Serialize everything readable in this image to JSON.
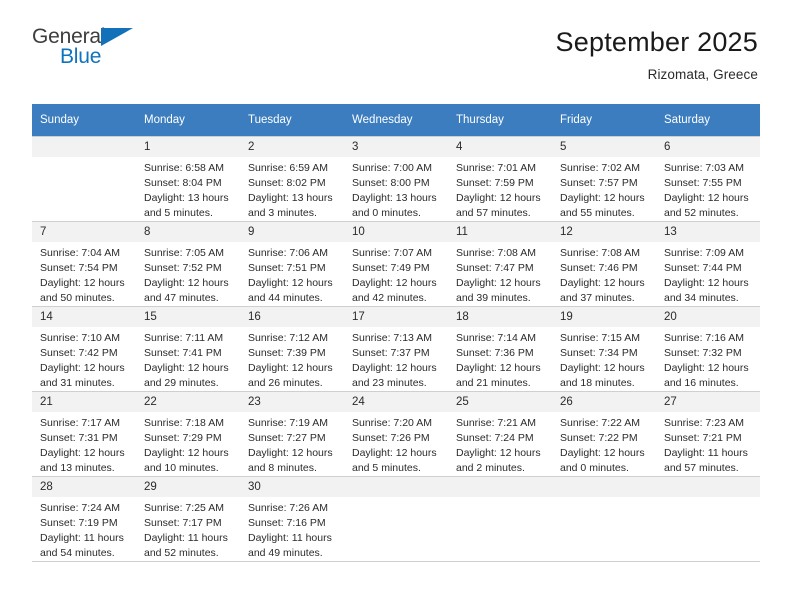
{
  "brand": {
    "name_part1": "General",
    "name_part2": "Blue",
    "accent_color": "#1271b8",
    "flag_icon": "triangle-flag-icon"
  },
  "header": {
    "title": "September 2025",
    "subtitle": "Rizomata, Greece"
  },
  "calendar": {
    "header_bg": "#3b7dbf",
    "daynum_bg": "#f2f2f2",
    "weekday_headers": [
      "Sunday",
      "Monday",
      "Tuesday",
      "Wednesday",
      "Thursday",
      "Friday",
      "Saturday"
    ],
    "weeks": [
      [
        {
          "day": "",
          "sunrise": "",
          "sunset": "",
          "daylight_line1": "",
          "daylight_line2": "",
          "blank": true
        },
        {
          "day": "1",
          "sunrise": "Sunrise: 6:58 AM",
          "sunset": "Sunset: 8:04 PM",
          "daylight_line1": "Daylight: 13 hours",
          "daylight_line2": "and 5 minutes."
        },
        {
          "day": "2",
          "sunrise": "Sunrise: 6:59 AM",
          "sunset": "Sunset: 8:02 PM",
          "daylight_line1": "Daylight: 13 hours",
          "daylight_line2": "and 3 minutes."
        },
        {
          "day": "3",
          "sunrise": "Sunrise: 7:00 AM",
          "sunset": "Sunset: 8:00 PM",
          "daylight_line1": "Daylight: 13 hours",
          "daylight_line2": "and 0 minutes."
        },
        {
          "day": "4",
          "sunrise": "Sunrise: 7:01 AM",
          "sunset": "Sunset: 7:59 PM",
          "daylight_line1": "Daylight: 12 hours",
          "daylight_line2": "and 57 minutes."
        },
        {
          "day": "5",
          "sunrise": "Sunrise: 7:02 AM",
          "sunset": "Sunset: 7:57 PM",
          "daylight_line1": "Daylight: 12 hours",
          "daylight_line2": "and 55 minutes."
        },
        {
          "day": "6",
          "sunrise": "Sunrise: 7:03 AM",
          "sunset": "Sunset: 7:55 PM",
          "daylight_line1": "Daylight: 12 hours",
          "daylight_line2": "and 52 minutes."
        }
      ],
      [
        {
          "day": "7",
          "sunrise": "Sunrise: 7:04 AM",
          "sunset": "Sunset: 7:54 PM",
          "daylight_line1": "Daylight: 12 hours",
          "daylight_line2": "and 50 minutes."
        },
        {
          "day": "8",
          "sunrise": "Sunrise: 7:05 AM",
          "sunset": "Sunset: 7:52 PM",
          "daylight_line1": "Daylight: 12 hours",
          "daylight_line2": "and 47 minutes."
        },
        {
          "day": "9",
          "sunrise": "Sunrise: 7:06 AM",
          "sunset": "Sunset: 7:51 PM",
          "daylight_line1": "Daylight: 12 hours",
          "daylight_line2": "and 44 minutes."
        },
        {
          "day": "10",
          "sunrise": "Sunrise: 7:07 AM",
          "sunset": "Sunset: 7:49 PM",
          "daylight_line1": "Daylight: 12 hours",
          "daylight_line2": "and 42 minutes."
        },
        {
          "day": "11",
          "sunrise": "Sunrise: 7:08 AM",
          "sunset": "Sunset: 7:47 PM",
          "daylight_line1": "Daylight: 12 hours",
          "daylight_line2": "and 39 minutes."
        },
        {
          "day": "12",
          "sunrise": "Sunrise: 7:08 AM",
          "sunset": "Sunset: 7:46 PM",
          "daylight_line1": "Daylight: 12 hours",
          "daylight_line2": "and 37 minutes."
        },
        {
          "day": "13",
          "sunrise": "Sunrise: 7:09 AM",
          "sunset": "Sunset: 7:44 PM",
          "daylight_line1": "Daylight: 12 hours",
          "daylight_line2": "and 34 minutes."
        }
      ],
      [
        {
          "day": "14",
          "sunrise": "Sunrise: 7:10 AM",
          "sunset": "Sunset: 7:42 PM",
          "daylight_line1": "Daylight: 12 hours",
          "daylight_line2": "and 31 minutes."
        },
        {
          "day": "15",
          "sunrise": "Sunrise: 7:11 AM",
          "sunset": "Sunset: 7:41 PM",
          "daylight_line1": "Daylight: 12 hours",
          "daylight_line2": "and 29 minutes."
        },
        {
          "day": "16",
          "sunrise": "Sunrise: 7:12 AM",
          "sunset": "Sunset: 7:39 PM",
          "daylight_line1": "Daylight: 12 hours",
          "daylight_line2": "and 26 minutes."
        },
        {
          "day": "17",
          "sunrise": "Sunrise: 7:13 AM",
          "sunset": "Sunset: 7:37 PM",
          "daylight_line1": "Daylight: 12 hours",
          "daylight_line2": "and 23 minutes."
        },
        {
          "day": "18",
          "sunrise": "Sunrise: 7:14 AM",
          "sunset": "Sunset: 7:36 PM",
          "daylight_line1": "Daylight: 12 hours",
          "daylight_line2": "and 21 minutes."
        },
        {
          "day": "19",
          "sunrise": "Sunrise: 7:15 AM",
          "sunset": "Sunset: 7:34 PM",
          "daylight_line1": "Daylight: 12 hours",
          "daylight_line2": "and 18 minutes."
        },
        {
          "day": "20",
          "sunrise": "Sunrise: 7:16 AM",
          "sunset": "Sunset: 7:32 PM",
          "daylight_line1": "Daylight: 12 hours",
          "daylight_line2": "and 16 minutes."
        }
      ],
      [
        {
          "day": "21",
          "sunrise": "Sunrise: 7:17 AM",
          "sunset": "Sunset: 7:31 PM",
          "daylight_line1": "Daylight: 12 hours",
          "daylight_line2": "and 13 minutes."
        },
        {
          "day": "22",
          "sunrise": "Sunrise: 7:18 AM",
          "sunset": "Sunset: 7:29 PM",
          "daylight_line1": "Daylight: 12 hours",
          "daylight_line2": "and 10 minutes."
        },
        {
          "day": "23",
          "sunrise": "Sunrise: 7:19 AM",
          "sunset": "Sunset: 7:27 PM",
          "daylight_line1": "Daylight: 12 hours",
          "daylight_line2": "and 8 minutes."
        },
        {
          "day": "24",
          "sunrise": "Sunrise: 7:20 AM",
          "sunset": "Sunset: 7:26 PM",
          "daylight_line1": "Daylight: 12 hours",
          "daylight_line2": "and 5 minutes."
        },
        {
          "day": "25",
          "sunrise": "Sunrise: 7:21 AM",
          "sunset": "Sunset: 7:24 PM",
          "daylight_line1": "Daylight: 12 hours",
          "daylight_line2": "and 2 minutes."
        },
        {
          "day": "26",
          "sunrise": "Sunrise: 7:22 AM",
          "sunset": "Sunset: 7:22 PM",
          "daylight_line1": "Daylight: 12 hours",
          "daylight_line2": "and 0 minutes."
        },
        {
          "day": "27",
          "sunrise": "Sunrise: 7:23 AM",
          "sunset": "Sunset: 7:21 PM",
          "daylight_line1": "Daylight: 11 hours",
          "daylight_line2": "and 57 minutes."
        }
      ],
      [
        {
          "day": "28",
          "sunrise": "Sunrise: 7:24 AM",
          "sunset": "Sunset: 7:19 PM",
          "daylight_line1": "Daylight: 11 hours",
          "daylight_line2": "and 54 minutes."
        },
        {
          "day": "29",
          "sunrise": "Sunrise: 7:25 AM",
          "sunset": "Sunset: 7:17 PM",
          "daylight_line1": "Daylight: 11 hours",
          "daylight_line2": "and 52 minutes."
        },
        {
          "day": "30",
          "sunrise": "Sunrise: 7:26 AM",
          "sunset": "Sunset: 7:16 PM",
          "daylight_line1": "Daylight: 11 hours",
          "daylight_line2": "and 49 minutes."
        },
        {
          "day": "",
          "sunrise": "",
          "sunset": "",
          "daylight_line1": "",
          "daylight_line2": "",
          "blank": true
        },
        {
          "day": "",
          "sunrise": "",
          "sunset": "",
          "daylight_line1": "",
          "daylight_line2": "",
          "blank": true
        },
        {
          "day": "",
          "sunrise": "",
          "sunset": "",
          "daylight_line1": "",
          "daylight_line2": "",
          "blank": true
        },
        {
          "day": "",
          "sunrise": "",
          "sunset": "",
          "daylight_line1": "",
          "daylight_line2": "",
          "blank": true
        }
      ]
    ]
  }
}
